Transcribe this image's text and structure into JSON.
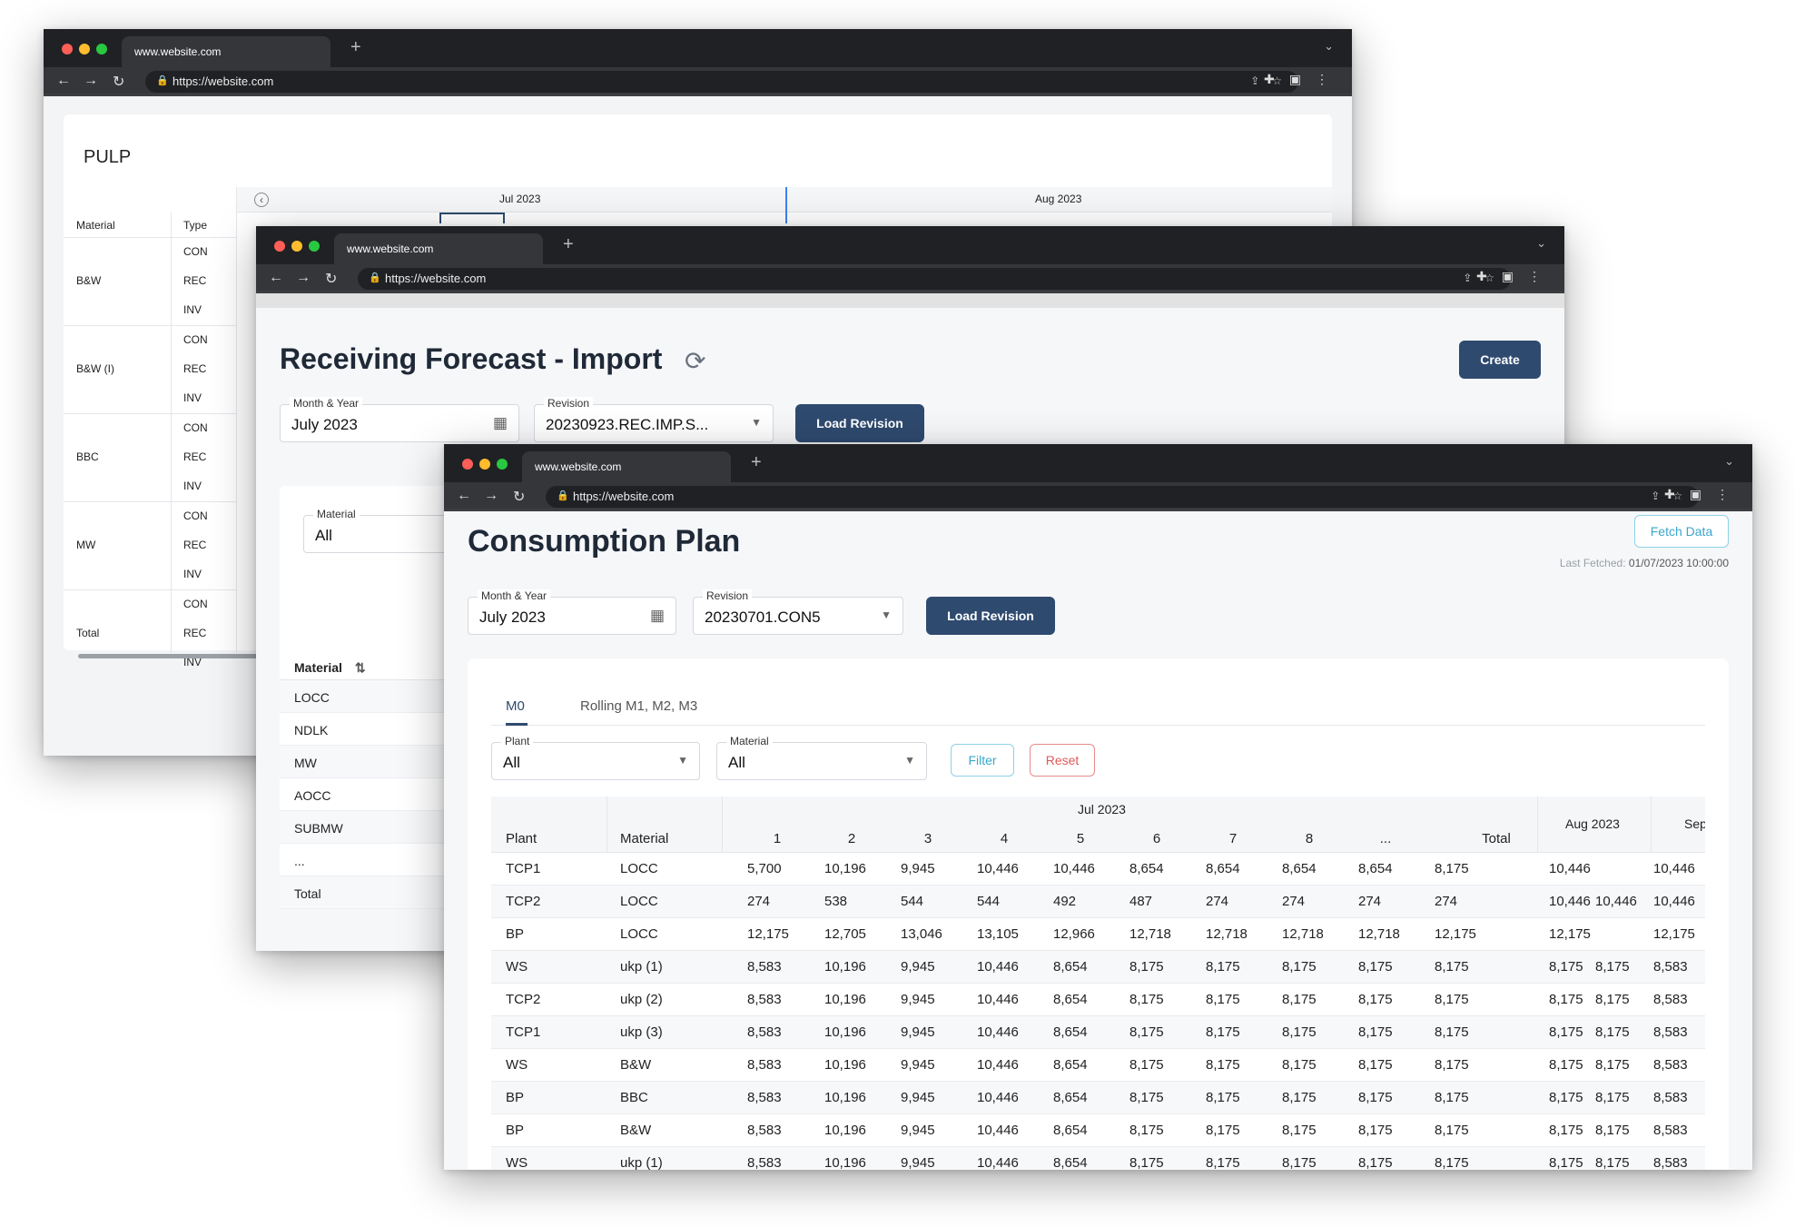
{
  "browser": {
    "tab_title": "www.website.com",
    "url": "https://website.com",
    "new_tab": "+"
  },
  "pulp": {
    "title": "PULP",
    "months": [
      "Jul 2023",
      "Aug 2023"
    ],
    "col_material": "Material",
    "col_type": "Type",
    "groups": [
      {
        "material": "B&W",
        "types": [
          "CON",
          "REC",
          "INV"
        ]
      },
      {
        "material": "B&W (I)",
        "types": [
          "CON",
          "REC",
          "INV"
        ]
      },
      {
        "material": "BBC",
        "types": [
          "CON",
          "REC",
          "INV"
        ]
      },
      {
        "material": "MW",
        "types": [
          "CON",
          "REC",
          "INV"
        ]
      },
      {
        "material": "Total",
        "types": [
          "CON",
          "REC",
          "INV"
        ]
      }
    ]
  },
  "receiving": {
    "title": "Receiving Forecast - Import",
    "create_label": "Create",
    "month_year_label": "Month & Year",
    "month_year_value": "July 2023",
    "revision_label": "Revision",
    "revision_value": "20230923.REC.IMP.S...",
    "load_revision_label": "Load Revision",
    "material_filter_label": "Material",
    "material_filter_value": "All",
    "list_header": "Material",
    "list_items": [
      "LOCC",
      "NDLK",
      "MW",
      "AOCC",
      "SUBMW",
      "...",
      "Total"
    ]
  },
  "consumption": {
    "title": "Consumption Plan",
    "fetch_label": "Fetch Data",
    "last_fetched_label": "Last Fetched:",
    "last_fetched_value": "01/07/2023  10:00:00",
    "month_year_label": "Month & Year",
    "month_year_value": "July 2023",
    "revision_label": "Revision",
    "revision_value": "20230701.CON5",
    "load_revision_label": "Load Revision",
    "tabs": [
      "M0",
      "Rolling M1, M2, M3"
    ],
    "plant_label": "Plant",
    "plant_value": "All",
    "material_label": "Material",
    "material_value": "All",
    "filter_label": "Filter",
    "reset_label": "Reset",
    "table": {
      "group_jul": "Jul 2023",
      "group_aug": "Aug 2023",
      "group_sep": "Sep",
      "col_plant": "Plant",
      "col_material": "Material",
      "day_cols": [
        "1",
        "2",
        "3",
        "4",
        "5",
        "6",
        "7",
        "8",
        "...",
        "Total"
      ],
      "rows": [
        {
          "plant": "TCP1",
          "material": "LOCC",
          "values": [
            "5,700",
            "10,196",
            "9,945",
            "10,446",
            "10,446",
            "8,654",
            "8,654",
            "8,654",
            "8,654",
            "8,175"
          ],
          "aug": [
            "10,446",
            ""
          ],
          "sep": "10,446"
        },
        {
          "plant": "TCP2",
          "material": "LOCC",
          "values": [
            "274",
            "538",
            "544",
            "544",
            "492",
            "487",
            "274",
            "274",
            "274",
            "274"
          ],
          "aug": [
            "10,446",
            "10,446"
          ],
          "sep": "10,446"
        },
        {
          "plant": "BP",
          "material": "LOCC",
          "values": [
            "12,175",
            "12,705",
            "13,046",
            "13,105",
            "12,966",
            "12,718",
            "12,718",
            "12,718",
            "12,718",
            "12,175"
          ],
          "aug": [
            "12,175",
            ""
          ],
          "sep": "12,175"
        },
        {
          "plant": "WS",
          "material": "ukp (1)",
          "values": [
            "8,583",
            "10,196",
            "9,945",
            "10,446",
            "8,654",
            "8,175",
            "8,175",
            "8,175",
            "8,175",
            "8,175"
          ],
          "aug": [
            "8,175",
            "8,175"
          ],
          "sep": "8,583"
        },
        {
          "plant": "TCP2",
          "material": "ukp (2)",
          "values": [
            "8,583",
            "10,196",
            "9,945",
            "10,446",
            "8,654",
            "8,175",
            "8,175",
            "8,175",
            "8,175",
            "8,175"
          ],
          "aug": [
            "8,175",
            "8,175"
          ],
          "sep": "8,583"
        },
        {
          "plant": "TCP1",
          "material": "ukp (3)",
          "values": [
            "8,583",
            "10,196",
            "9,945",
            "10,446",
            "8,654",
            "8,175",
            "8,175",
            "8,175",
            "8,175",
            "8,175"
          ],
          "aug": [
            "8,175",
            "8,175"
          ],
          "sep": "8,583"
        },
        {
          "plant": "WS",
          "material": "B&W",
          "values": [
            "8,583",
            "10,196",
            "9,945",
            "10,446",
            "8,654",
            "8,175",
            "8,175",
            "8,175",
            "8,175",
            "8,175"
          ],
          "aug": [
            "8,175",
            "8,175"
          ],
          "sep": "8,583"
        },
        {
          "plant": "BP",
          "material": "BBC",
          "values": [
            "8,583",
            "10,196",
            "9,945",
            "10,446",
            "8,654",
            "8,175",
            "8,175",
            "8,175",
            "8,175",
            "8,175"
          ],
          "aug": [
            "8,175",
            "8,175"
          ],
          "sep": "8,583"
        },
        {
          "plant": "BP",
          "material": "B&W",
          "values": [
            "8,583",
            "10,196",
            "9,945",
            "10,446",
            "8,654",
            "8,175",
            "8,175",
            "8,175",
            "8,175",
            "8,175"
          ],
          "aug": [
            "8,175",
            "8,175"
          ],
          "sep": "8,583"
        },
        {
          "plant": "WS",
          "material": "ukp (1)",
          "values": [
            "8,583",
            "10,196",
            "9,945",
            "10,446",
            "8,654",
            "8,175",
            "8,175",
            "8,175",
            "8,175",
            "8,175"
          ],
          "aug": [
            "8,175",
            "8,175"
          ],
          "sep": "8,583"
        }
      ]
    }
  },
  "colors": {
    "primary": "#2f4a6f",
    "filter": "#3aa6cc",
    "reset": "#e05a5a"
  }
}
